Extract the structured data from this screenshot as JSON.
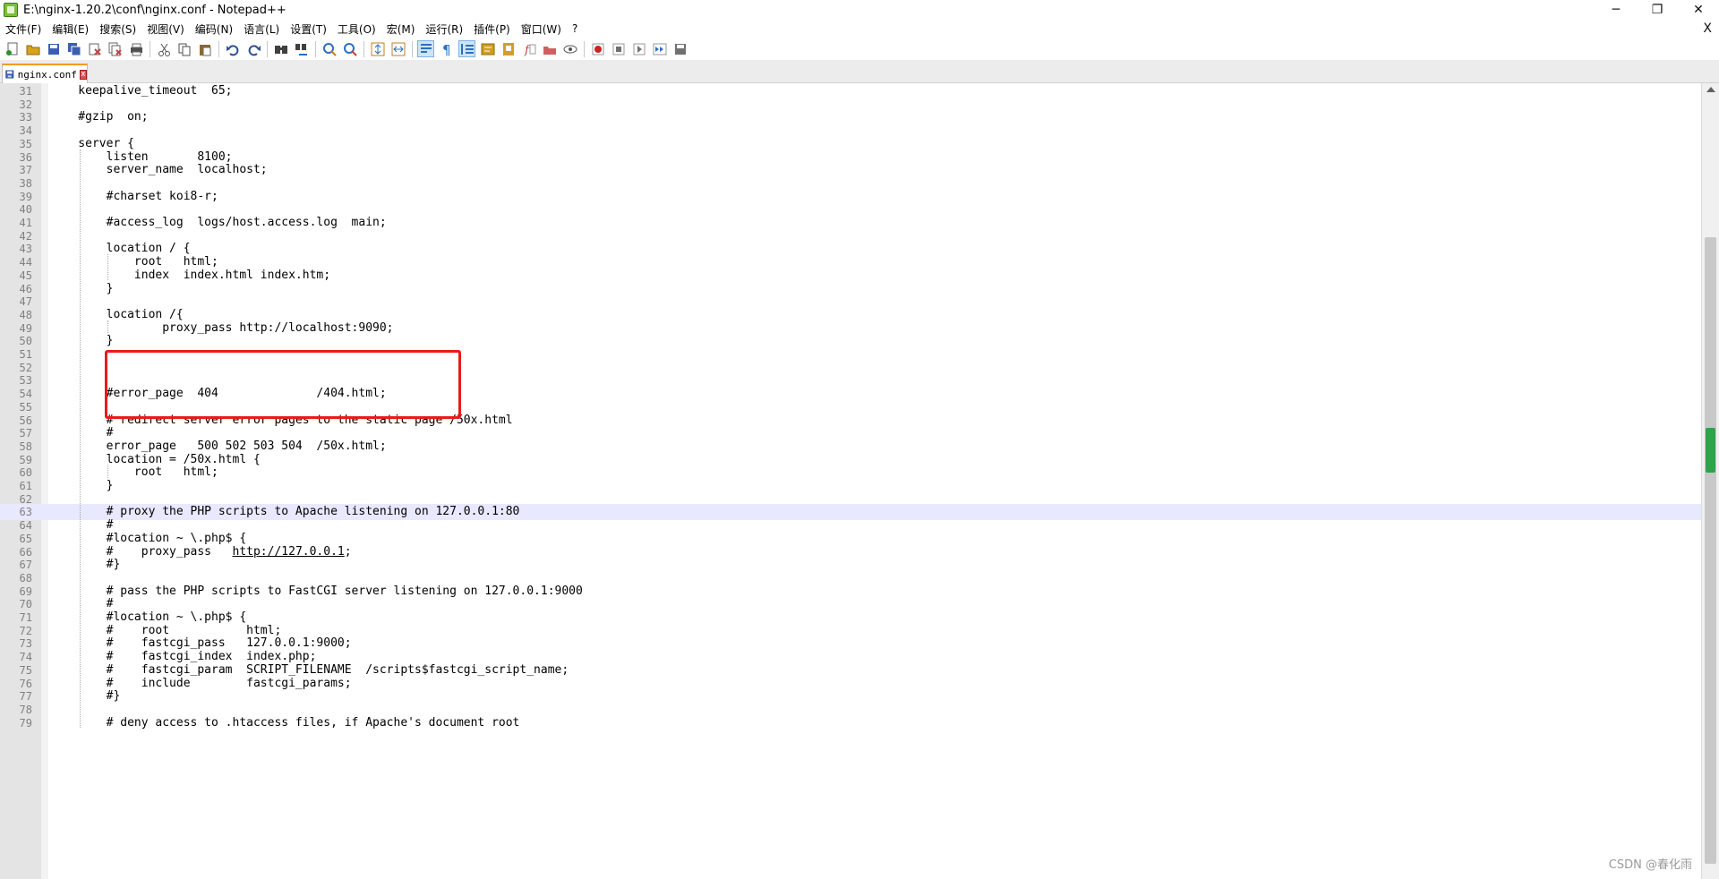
{
  "window": {
    "title": "E:\\nginx-1.20.2\\conf\\nginx.conf - Notepad++",
    "minimize_label": "─",
    "restore_label": "❐",
    "close_label": "✕"
  },
  "menu": {
    "items": [
      "文件(F)",
      "编辑(E)",
      "搜索(S)",
      "视图(V)",
      "编码(N)",
      "语言(L)",
      "设置(T)",
      "工具(O)",
      "宏(M)",
      "运行(R)",
      "插件(P)",
      "窗口(W)",
      "?"
    ],
    "close_label": "X"
  },
  "toolbar": {
    "buttons": [
      {
        "name": "new-file-icon",
        "color": "#2f8f2f"
      },
      {
        "name": "open-file-icon",
        "color": "#d8a21a"
      },
      {
        "name": "save-icon",
        "color": "#3a5fb0"
      },
      {
        "name": "save-all-icon",
        "color": "#3a5fb0"
      },
      {
        "name": "close-icon",
        "color": "#c04040"
      },
      {
        "name": "close-all-icon",
        "color": "#c04040"
      },
      {
        "name": "print-icon",
        "color": "#505050"
      },
      {
        "sep": true
      },
      {
        "name": "cut-icon",
        "color": "#505050"
      },
      {
        "name": "copy-icon",
        "color": "#505050"
      },
      {
        "name": "paste-icon",
        "color": "#8a6a2a"
      },
      {
        "sep": true
      },
      {
        "name": "undo-icon",
        "color": "#305090"
      },
      {
        "name": "redo-icon",
        "color": "#305090"
      },
      {
        "sep": true
      },
      {
        "name": "find-icon",
        "color": "#404040"
      },
      {
        "name": "replace-icon",
        "color": "#2a70c0"
      },
      {
        "sep": true
      },
      {
        "name": "zoom-in-icon",
        "color": "#2a70c0"
      },
      {
        "name": "zoom-out-icon",
        "color": "#2a70c0"
      },
      {
        "sep": true
      },
      {
        "name": "sync-vertical-icon",
        "color": "#c08020"
      },
      {
        "name": "sync-horizontal-icon",
        "color": "#c08020"
      },
      {
        "sep": true
      },
      {
        "name": "word-wrap-icon",
        "color": "#2a70c0",
        "active": true
      },
      {
        "name": "show-all-chars-icon",
        "color": "#2a70c0"
      },
      {
        "name": "indent-guide-icon",
        "color": "#2a70c0",
        "active": true
      },
      {
        "name": "language-icon",
        "color": "#d0a020"
      },
      {
        "name": "doc-map-icon",
        "color": "#d0a020"
      },
      {
        "name": "function-list-icon",
        "color": "#c04040"
      },
      {
        "name": "folder-workspace-icon",
        "color": "#d06060"
      },
      {
        "name": "monitor-icon",
        "color": "#505050"
      },
      {
        "sep": true
      },
      {
        "name": "record-macro-icon",
        "color": "#d02020"
      },
      {
        "name": "stop-record-icon",
        "color": "#707070"
      },
      {
        "name": "play-macro-icon",
        "color": "#707070"
      },
      {
        "name": "run-macro-multiple-icon",
        "color": "#2a70c0"
      },
      {
        "name": "save-macro-icon",
        "color": "#707070"
      }
    ]
  },
  "tab": {
    "label": "nginx.conf",
    "close_label": "x"
  },
  "editor": {
    "current_line": 63,
    "lines": [
      {
        "n": 31,
        "t": "    keepalive_timeout  65;"
      },
      {
        "n": 32,
        "t": ""
      },
      {
        "n": 33,
        "t": "    #gzip  on;"
      },
      {
        "n": 34,
        "t": ""
      },
      {
        "n": 35,
        "t": "    server {"
      },
      {
        "n": 36,
        "t": "        listen       8100;"
      },
      {
        "n": 37,
        "t": "        server_name  localhost;"
      },
      {
        "n": 38,
        "t": ""
      },
      {
        "n": 39,
        "t": "        #charset koi8-r;"
      },
      {
        "n": 40,
        "t": ""
      },
      {
        "n": 41,
        "t": "        #access_log  logs/host.access.log  main;"
      },
      {
        "n": 42,
        "t": ""
      },
      {
        "n": 43,
        "t": "        location / {"
      },
      {
        "n": 44,
        "t": "            root   html;"
      },
      {
        "n": 45,
        "t": "            index  index.html index.htm;"
      },
      {
        "n": 46,
        "t": "        }"
      },
      {
        "n": 47,
        "t": ""
      },
      {
        "n": 48,
        "t": "        location /{"
      },
      {
        "n": 49,
        "t": "                proxy_pass http://localhost:9090;"
      },
      {
        "n": 50,
        "t": "        }"
      },
      {
        "n": 51,
        "t": ""
      },
      {
        "n": 52,
        "t": ""
      },
      {
        "n": 53,
        "t": ""
      },
      {
        "n": 54,
        "t": "        #error_page  404              /404.html;"
      },
      {
        "n": 55,
        "t": ""
      },
      {
        "n": 56,
        "t": "        # redirect server error pages to the static page /50x.html"
      },
      {
        "n": 57,
        "t": "        #"
      },
      {
        "n": 58,
        "t": "        error_page   500 502 503 504  /50x.html;"
      },
      {
        "n": 59,
        "t": "        location = /50x.html {"
      },
      {
        "n": 60,
        "t": "            root   html;"
      },
      {
        "n": 61,
        "t": "        }"
      },
      {
        "n": 62,
        "t": ""
      },
      {
        "n": 63,
        "t": "        # proxy the PHP scripts to Apache listening on 127.0.0.1:80"
      },
      {
        "n": 64,
        "t": "        #"
      },
      {
        "n": 65,
        "t": "        #location ~ \\.php$ {"
      },
      {
        "n": 66,
        "t": "        #    proxy_pass   ",
        "url": "http://127.0.0.1",
        "after": ";"
      },
      {
        "n": 67,
        "t": "        #}"
      },
      {
        "n": 68,
        "t": ""
      },
      {
        "n": 69,
        "t": "        # pass the PHP scripts to FastCGI server listening on 127.0.0.1:9000"
      },
      {
        "n": 70,
        "t": "        #"
      },
      {
        "n": 71,
        "t": "        #location ~ \\.php$ {"
      },
      {
        "n": 72,
        "t": "        #    root           html;"
      },
      {
        "n": 73,
        "t": "        #    fastcgi_pass   127.0.0.1:9000;"
      },
      {
        "n": 74,
        "t": "        #    fastcgi_index  index.php;"
      },
      {
        "n": 75,
        "t": "        #    fastcgi_param  SCRIPT_FILENAME  /scripts$fastcgi_script_name;"
      },
      {
        "n": 76,
        "t": "        #    include        fastcgi_params;"
      },
      {
        "n": 77,
        "t": "        #}"
      },
      {
        "n": 78,
        "t": ""
      },
      {
        "n": 79,
        "t": "        # deny access to .htaccess files, if Apache's document root"
      }
    ]
  },
  "watermark": "CSDN @春化雨"
}
